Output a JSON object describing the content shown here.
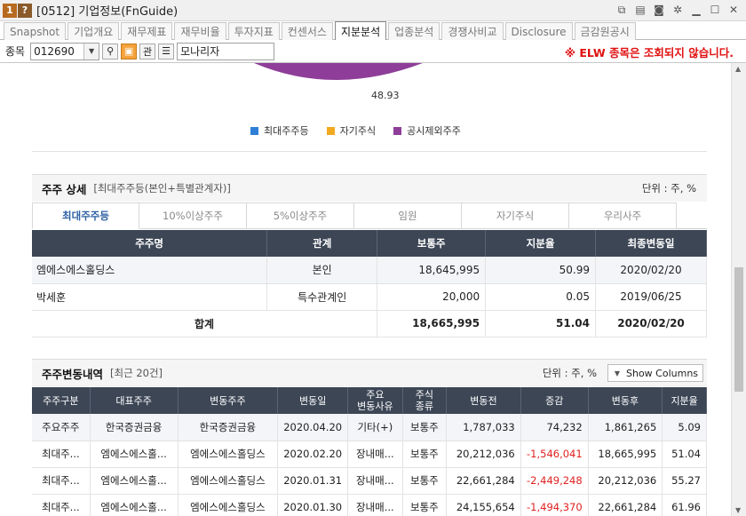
{
  "window": {
    "badge_num": "1",
    "badge_q": "?",
    "title": "[0512] 기업정보(FnGuide)"
  },
  "tabs": [
    "Snapshot",
    "기업개요",
    "재무제표",
    "재무비율",
    "투자지표",
    "컨센서스",
    "지분분석",
    "업종분석",
    "경쟁사비교",
    "Disclosure",
    "금감원공시"
  ],
  "active_tab": "지분분석",
  "search": {
    "label": "종목",
    "code": "012690",
    "gwan_label": "관",
    "company_name": "모나리자",
    "warning": "※ ELW 종목은 조회되지 않습니다."
  },
  "pie": {
    "label": "48.93",
    "legend": [
      {
        "name": "최대주주등",
        "color": "#2f7fd6"
      },
      {
        "name": "자기주식",
        "color": "#f2a922"
      },
      {
        "name": "공시제외주주",
        "color": "#8e3e99"
      }
    ]
  },
  "detail": {
    "title": "주주 상세",
    "subtitle": "[최대주주등(본인+특별관계자)]",
    "unit": "단위 : 주, %",
    "subtabs": [
      "최대주주등",
      "10%이상주주",
      "5%이상주주",
      "임원",
      "자기주식",
      "우리사주"
    ],
    "active_subtab": 0,
    "columns": [
      "주주명",
      "관계",
      "보통주",
      "지분율",
      "최종변동일"
    ],
    "rows": [
      {
        "name": "엠에스에스홀딩스",
        "relation": "본인",
        "shares": "18,645,995",
        "ratio": "50.99",
        "date": "2020/02/20"
      },
      {
        "name": "박세훈",
        "relation": "특수관계인",
        "shares": "20,000",
        "ratio": "0.05",
        "date": "2019/06/25"
      }
    ],
    "total": {
      "label": "합계",
      "shares": "18,665,995",
      "ratio": "51.04",
      "date": "2020/02/20"
    }
  },
  "changes": {
    "title": "주주변동내역",
    "subtitle": "[최근 20건]",
    "unit": "단위 : 주, %",
    "show_columns": "Show Columns",
    "columns": [
      "주주구분",
      "대표주주",
      "변동주주",
      "변동일",
      "주요\n변동사유",
      "주식\n종류",
      "변동전",
      "증감",
      "변동후",
      "지분율"
    ],
    "rows": [
      {
        "type": "주요주주",
        "rep": "한국증권금융",
        "holder": "한국증권금융",
        "date": "2020.04.20",
        "reason": "기타(+)",
        "kind": "보통주",
        "before": "1,787,033",
        "change": "74,232",
        "after": "1,861,265",
        "ratio": "5.09",
        "negative": false
      },
      {
        "type": "최대주...",
        "rep": "엠에스에스홀...",
        "holder": "엠에스에스홀딩스",
        "date": "2020.02.20",
        "reason": "장내매...",
        "kind": "보통주",
        "before": "20,212,036",
        "change": "-1,546,041",
        "after": "18,665,995",
        "ratio": "51.04",
        "negative": true
      },
      {
        "type": "최대주...",
        "rep": "엠에스에스홀...",
        "holder": "엠에스에스홀딩스",
        "date": "2020.01.31",
        "reason": "장내매...",
        "kind": "보통주",
        "before": "22,661,284",
        "change": "-2,449,248",
        "after": "20,212,036",
        "ratio": "55.27",
        "negative": true
      },
      {
        "type": "최대주...",
        "rep": "엠에스에스홀...",
        "holder": "엠에스에스홀딩스",
        "date": "2020.01.30",
        "reason": "장내매...",
        "kind": "보통주",
        "before": "24,155,654",
        "change": "-1,494,370",
        "after": "22,661,284",
        "ratio": "61.96",
        "negative": true
      }
    ]
  }
}
